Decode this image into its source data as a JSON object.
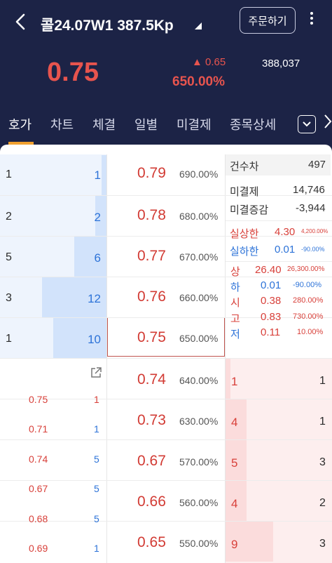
{
  "header": {
    "back_icon": "chevron-left-icon",
    "title": "콜24.07W1 387.5Kp",
    "order_button": "주문하기",
    "more_icon": "more-vertical-icon",
    "price": "0.75",
    "change": "▲ 0.65",
    "change_pct": "650.00%",
    "volume": "388,037"
  },
  "tabs": [
    "호가",
    "차트",
    "체결",
    "일별",
    "미결제",
    "종목상세"
  ],
  "colors": {
    "header_bg": "#1c2346",
    "up": "#d23b34",
    "down": "#2d73d8",
    "ask_bg": "#eef4fd",
    "bid_bg": "#fdeeee",
    "tab_underline": "#f0a030"
  },
  "asks": [
    {
      "count": "1",
      "qty": "1",
      "price": "0.79",
      "rate": "690.00%",
      "fill": 0.08
    },
    {
      "count": "2",
      "qty": "2",
      "price": "0.78",
      "rate": "680.00%",
      "fill": 0.17
    },
    {
      "count": "5",
      "qty": "6",
      "price": "0.77",
      "rate": "670.00%",
      "fill": 0.5
    },
    {
      "count": "3",
      "qty": "12",
      "price": "0.76",
      "rate": "660.00%",
      "fill": 1.0
    },
    {
      "count": "1",
      "qty": "10",
      "price": "0.75",
      "rate": "650.00%",
      "fill": 0.83
    }
  ],
  "bids": [
    {
      "price": "0.74",
      "rate": "640.00%",
      "qty": "1",
      "count": "1",
      "fill": 0.11
    },
    {
      "price": "0.73",
      "rate": "630.00%",
      "qty": "4",
      "count": "1",
      "fill": 0.44
    },
    {
      "price": "0.67",
      "rate": "570.00%",
      "qty": "5",
      "count": "3",
      "fill": 0.44
    },
    {
      "price": "0.66",
      "rate": "560.00%",
      "qty": "4",
      "count": "2",
      "fill": 0.44
    },
    {
      "price": "0.65",
      "rate": "550.00%",
      "qty": "9",
      "count": "3",
      "fill": 1.0
    }
  ],
  "trades": [
    {
      "price": "0.75",
      "qty": "1",
      "qty_color": "red"
    },
    {
      "price": "0.71",
      "qty": "1",
      "qty_color": "blue"
    },
    {
      "price": "0.74",
      "qty": "5",
      "qty_color": "blue"
    },
    {
      "price": "0.67",
      "qty": "5",
      "qty_color": "blue"
    },
    {
      "price": "0.68",
      "qty": "5",
      "qty_color": "blue"
    },
    {
      "price": "0.69",
      "qty": "1",
      "qty_color": "blue"
    }
  ],
  "info": {
    "gunsucha_label": "건수차",
    "gunsucha_value": "497",
    "open_interest_label": "미결제",
    "open_interest_value": "14,746",
    "oi_change_label": "미결증감",
    "oi_change_value": "-3,944",
    "real_upper_label": "실상한",
    "real_upper_value": "4.30",
    "real_upper_pct": "4,200.00%",
    "real_lower_label": "실하한",
    "real_lower_value": "0.01",
    "real_lower_pct": "-90.00%",
    "upper_label": "상",
    "upper_value": "26.40",
    "upper_pct": "26,300.00%",
    "lower_label": "하",
    "lower_value": "0.01",
    "lower_pct": "-90.00%",
    "open_label": "시",
    "open_value": "0.38",
    "open_pct": "280.00%",
    "high_label": "고",
    "high_value": "0.83",
    "high_pct": "730.00%",
    "low_label": "저",
    "low_value": "0.11",
    "low_pct": "10.00%"
  }
}
